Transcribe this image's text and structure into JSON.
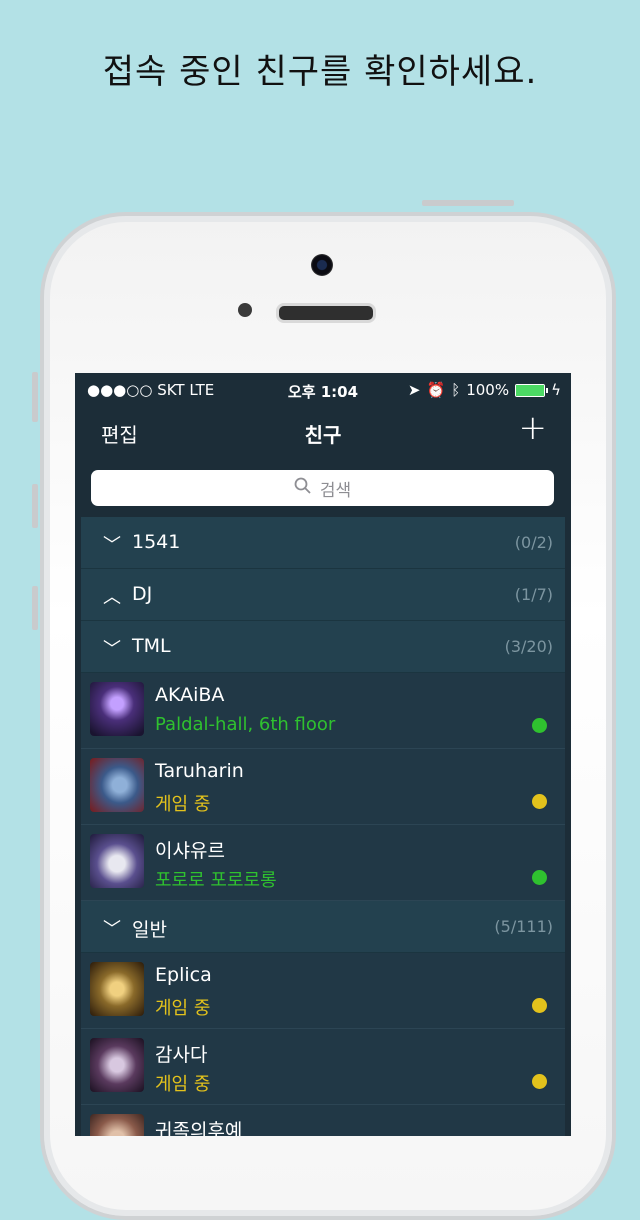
{
  "headline": "접속 중인 친구를 확인하세요.",
  "status_bar": {
    "carrier": "●●●○○ SKT   LTE",
    "time": "오후 1:04",
    "battery": "100%"
  },
  "nav": {
    "edit": "편집",
    "title": "친구",
    "add": "+"
  },
  "search": {
    "placeholder": "검색"
  },
  "groups": [
    {
      "chevron": "﹀",
      "name": "1541",
      "count": "(0/2)"
    },
    {
      "chevron": "︿",
      "name": "DJ",
      "count": "(1/7)"
    },
    {
      "chevron": "﹀",
      "name": "TML",
      "count": "(3/20)"
    },
    {
      "chevron": "﹀",
      "name": "일반",
      "count": "(5/111)"
    }
  ],
  "friends": [
    {
      "name": "AKAiBA",
      "status": "Paldal-hall, 6th floor",
      "state": "online",
      "dot_color": "#2fc12f",
      "avatar_color": "#4a2f7a"
    },
    {
      "name": "Taruharin",
      "status": "게임 중",
      "state": "in-game",
      "dot_color": "#e3c21c",
      "avatar_color": "#3b5a8a"
    },
    {
      "name": "이샤유르",
      "status": "포로로 포로로롱",
      "state": "online",
      "dot_color": "#2fc12f",
      "avatar_color": "#5a4f8e"
    },
    {
      "name": "Eplica",
      "status": "게임 중",
      "state": "in-game",
      "dot_color": "#e3c21c",
      "avatar_color": "#8a6a2a"
    },
    {
      "name": "감사다",
      "status": "게임 중",
      "state": "in-game",
      "dot_color": "#e3c21c",
      "avatar_color": "#5a3a5e"
    },
    {
      "name": "귀족의후예",
      "status": "",
      "state": "",
      "dot_color": "",
      "avatar_color": "#8a5a4a"
    }
  ]
}
